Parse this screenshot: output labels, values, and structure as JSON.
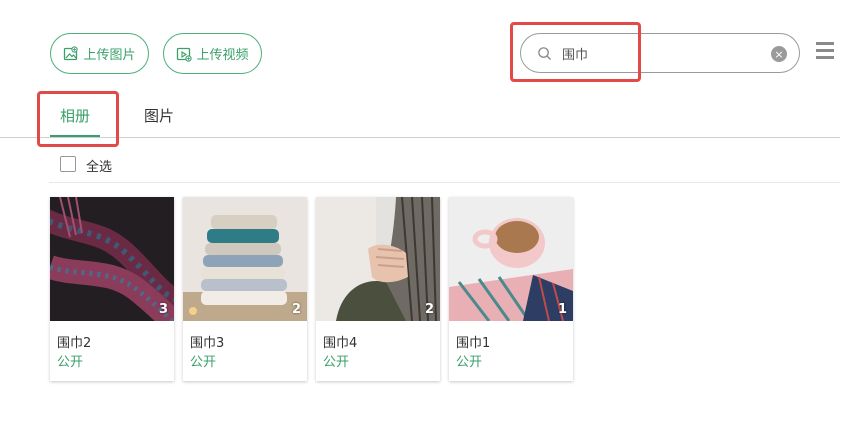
{
  "toolbar": {
    "upload_image_label": "上传图片",
    "upload_video_label": "上传视频"
  },
  "search": {
    "value": "围巾",
    "placeholder": ""
  },
  "tabs": [
    {
      "label": "相册",
      "active": true
    },
    {
      "label": "图片",
      "active": false
    }
  ],
  "select_all": {
    "label": "全选",
    "checked": false
  },
  "albums": [
    {
      "name": "围巾2",
      "status": "公开",
      "count": "3"
    },
    {
      "name": "围巾3",
      "status": "公开",
      "count": "2"
    },
    {
      "name": "围巾4",
      "status": "公开",
      "count": "2"
    },
    {
      "name": "围巾1",
      "status": "公开",
      "count": "1"
    }
  ],
  "colors": {
    "accent": "#3aa06a",
    "highlight": "#e24a4a"
  }
}
